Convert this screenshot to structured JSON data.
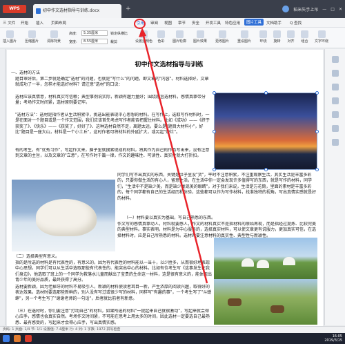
{
  "titlebar": {
    "app_label": "WPS",
    "tab_title": "初中作文选材指导与训练.docx",
    "plus": "+",
    "user_label": "稻米失手上吊"
  },
  "menubar": {
    "items": [
      "三 文件",
      "开始",
      "插入",
      "页面布局",
      "引用",
      "审阅",
      "视图",
      "章节",
      "安全",
      "开发工具",
      "特色应用",
      "图片工具",
      "文档助手",
      "Q 查找"
    ],
    "active_index": 11,
    "highlight_index": 4
  },
  "ribbon": {
    "buttons": [
      "插入图片",
      "压缩图片",
      "清除背景",
      "设置透明色",
      "色彩",
      "图片轮廓",
      "图片效果",
      "更改图片",
      "重设图片",
      "环绕",
      "旋转",
      "对齐",
      "组合",
      "文字环绕"
    ],
    "height_label": "高度:",
    "height_value": "5.35厘米",
    "width_label": "宽度:",
    "width_value": "8.55厘米",
    "lock_label": "锁定纵横比",
    "crop_label": "裁剪"
  },
  "document": {
    "title": "初中作文选材指导与训练",
    "heading1": "一、选材的方法",
    "p1": "题目审好后，第二步就是确定\"选材\"的问题，也就是\"写什么\"的问题，即文章的\"内容\"。材料选择好，文章就成功了一半，怎样才能选好材料？请注意\"选材\"的口诀：",
    "p2": "选材应该真情意，材料真实可信赖；典型事例说实际，新颖有趣力量好；围绕题旨选材料，感情真挚带分量；考场作文时间紧，选材原则要记牢。",
    "p3": "\"选材方法\"：选材是指作者从生活积累中，挑选出能表现中心思想的材料。在写作上，选取写作材料时，一是在面对一个题目或是一个作文范围，我们应该首先考虑写作者能否把握住材料。比如《成功》——《终于获奖了》、《快乐》——《获奖了，好好了》、这种选材自然不足，离题太远，要么是\"题目大材料小\"，好比\"题目是一座大山，材料是一个小土丘\"，这时作者可将材料的外延扩大，或另起\"炉灶\"。",
    "p4": "有的考生，有\"优秀习作\"，写起作文来，脑子里就搜索现成的材料，将其作为自己的作品写出来，没有注意到文章的主旨，以及文章的\"立意\"，在写作时千篇一律，作文的趣味性、可读性、真实性就大打折扣。",
    "p5": "同学们写不出真实的东西，关键是肚子里没\"货\"，平时不注意积累，不注重观察生活，其实生活是丰富多彩的，只要你做生活的有心人，留意生活，在生活中你一定会发现许多值得写的东西，就是写作的材料，同学们，\"生活中不是缺少美，而是缺少发现美的眼睛\"。对于我们来说，生活是万花筒，里面的素材是丰富多彩的，每个同学都有自己的生活经历和体验，这些都可以作为写作材料，找准独特的视角，写出真情实感就是好的材料。",
    "p6": "（一）材料要以真实为基础，写自己熟悉的东西。",
    "p7": "作文写的感情真挚动人，材料就要感人，作文的材料真实不是指材料的原始再现，而是指经过提炼、比较完美的典型材料。事实表明，材料是为中心服务的，选择真实材料，可以使文章更有说服力，更加真实可信，在选择材料时，应是自己所熟悉的材料。选材时要注意材料的真实性、典型性与新颖性。",
    "heading2": "（二）选择典型有意义。",
    "p8": "指的是所选的材料是有代表性的，有意义的，因为有代表性的材料能以一当十，以少胜多，从而很好地表现中心思想。同学们可以从生活中选取那些有代表性的、能突出中心的材料。比如有位考生写《这事发生在我们身边》，他选取了班上的一个同学为救落水儿童而献出了宝贵的生命这一材料，这是很有意义的，能体现出青少年的美好品质，最终获得了高分。",
    "p9": "选材要新颖，因为老掉牙的材料不易吸引人，新颖的材料使读者耳目一新，产生浓厚的阅读兴趣，取得好的表达效果。选材时要选那些新鲜的，别人没有写过或很少写的材料，同样写\"有趣的事\"，一个考生写了\"斗蟋蟀\"，另一个考生写了\"谢谢老师的一句话\"，后者就比前者有新意。",
    "p10": "（三）在选材时，你们要注意\"打动自己\"的材料，如果所选的材料\"一提起来自己就很激动\"，写起来就会得心应手，感情也会真实自然。考场作文时间紧，不可能在思考上用太多的时间，因此选材一定要选自己最熟悉、最有感受的，写起来才会得心应手，写出真情实感。"
  },
  "statusbar": {
    "text": "页码: 1  页面: 1/4  节: 1/1  设置值: 7.4厘米  行: 4  列: 1  字数: 1972  拼写检查"
  },
  "taskbar": {
    "time": "16:05",
    "date": "2019/3/15"
  },
  "colors": {
    "accent": "#2f6fd6",
    "annotation": "#e8232a",
    "titlebar": "#3a3f4b"
  }
}
